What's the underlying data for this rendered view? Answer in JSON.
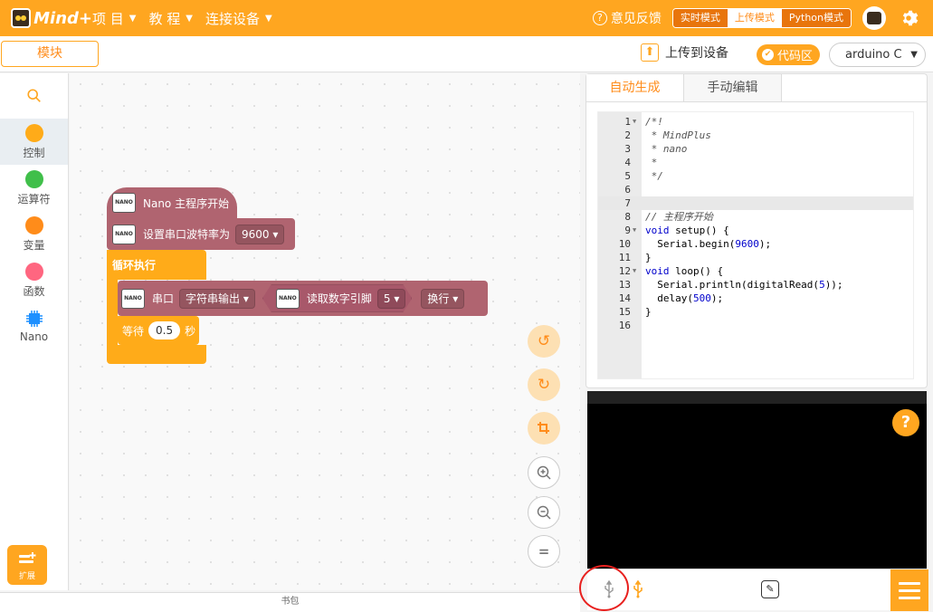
{
  "app": {
    "logo_text": "Mind+"
  },
  "menu": [
    {
      "label": "项 目"
    },
    {
      "label": "教 程"
    },
    {
      "label": "连接设备"
    }
  ],
  "topbar": {
    "feedback_label": "意见反馈",
    "modes": [
      {
        "label": "实时模式",
        "active": false
      },
      {
        "label": "上传模式",
        "active": true
      },
      {
        "label": "Python模式",
        "active": false
      }
    ]
  },
  "subbar": {
    "blocks_tab": "模块",
    "upload_label": "上传到设备",
    "code_area_label": "代码区",
    "board_value": "arduino C"
  },
  "categories": [
    {
      "label": "控制",
      "color": "#ffab19",
      "active": true
    },
    {
      "label": "运算符",
      "color": "#40bf4a",
      "active": false
    },
    {
      "label": "变量",
      "color": "#ff8c1a",
      "active": false
    },
    {
      "label": "函数",
      "color": "#ff6680",
      "active": false
    },
    {
      "label": "Nano",
      "color": "#1e90ff",
      "active": false
    }
  ],
  "extend_label": "扩展",
  "blocks": {
    "hat": "Nano 主程序开始",
    "baud_label": "设置串口波特率为",
    "baud_value": "9600",
    "loop_label": "循环执行",
    "serial_label": "串口",
    "serial_mode": "字符串输出",
    "read_pin_label": "读取数字引脚",
    "pin_value": "5",
    "newline_label": "换行",
    "wait_label": "等待",
    "wait_value": "0.5",
    "wait_unit": "秒",
    "nano_chip_text": "NANO"
  },
  "footer_bag": "书包",
  "code_tabs": [
    {
      "label": "自动生成",
      "active": true
    },
    {
      "label": "手动编辑",
      "active": false
    }
  ],
  "code_lines": [
    {
      "n": "1",
      "fold": true,
      "text": "/*!"
    },
    {
      "n": "2",
      "fold": false,
      "text": " * MindPlus"
    },
    {
      "n": "3",
      "fold": false,
      "text": " * nano"
    },
    {
      "n": "4",
      "fold": false,
      "text": " *"
    },
    {
      "n": "5",
      "fold": false,
      "text": " */"
    },
    {
      "n": "6",
      "fold": false,
      "text": ""
    },
    {
      "n": "7",
      "fold": false,
      "text": ""
    },
    {
      "n": "8",
      "fold": false,
      "text": "// 主程序开始"
    },
    {
      "n": "9",
      "fold": true,
      "text": "void setup() {"
    },
    {
      "n": "10",
      "fold": false,
      "text": "  Serial.begin(9600);"
    },
    {
      "n": "11",
      "fold": false,
      "text": "}"
    },
    {
      "n": "12",
      "fold": true,
      "text": "void loop() {"
    },
    {
      "n": "13",
      "fold": false,
      "text": "  Serial.println(digitalRead(5));"
    },
    {
      "n": "14",
      "fold": false,
      "text": "  delay(500);"
    },
    {
      "n": "15",
      "fold": false,
      "text": "}"
    },
    {
      "n": "16",
      "fold": false,
      "text": ""
    }
  ],
  "serial": {
    "help_label": "?"
  }
}
